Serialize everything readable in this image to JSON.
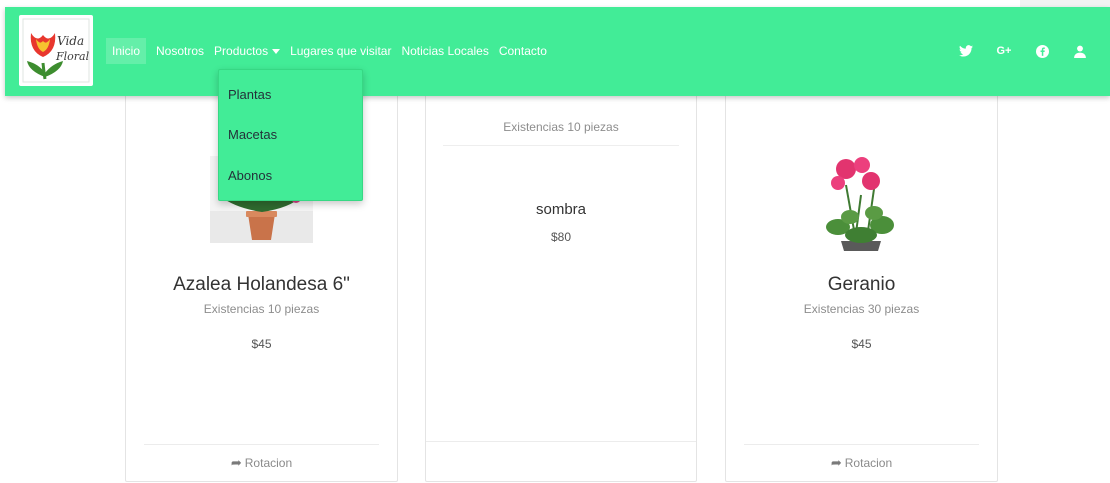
{
  "brand": {
    "logo_alt": "Vida Floral",
    "logo_line1": "Vida",
    "logo_line2": "Floral"
  },
  "nav": {
    "items": [
      {
        "label": "Inicio",
        "active": true
      },
      {
        "label": "Nosotros"
      },
      {
        "label": "Productos",
        "has_dropdown": true
      },
      {
        "label": "Lugares que visitar"
      },
      {
        "label": "Noticias Locales"
      },
      {
        "label": "Contacto"
      }
    ],
    "dropdown": [
      {
        "label": "Plantas"
      },
      {
        "label": "Macetas"
      },
      {
        "label": "Abonos"
      }
    ],
    "social_icons": [
      "twitter-icon",
      "google-plus-icon",
      "facebook-icon",
      "user-icon"
    ],
    "social_labels": {
      "gplus": "G+"
    }
  },
  "colors": {
    "navbar": "#42ec97",
    "text_dark": "#333333",
    "muted": "#8d8d8d"
  },
  "products": [
    {
      "name": "Azalea Holandesa 6\"",
      "stock": "Existencias 10 piezas",
      "price": "$45",
      "footer": "Rotacion"
    },
    {
      "name": "sombra",
      "stock": "Existencias 10 piezas",
      "price": "$80"
    },
    {
      "name": "Geranio",
      "stock": "Existencias 30 piezas",
      "price": "$45",
      "footer": "Rotacion"
    }
  ]
}
